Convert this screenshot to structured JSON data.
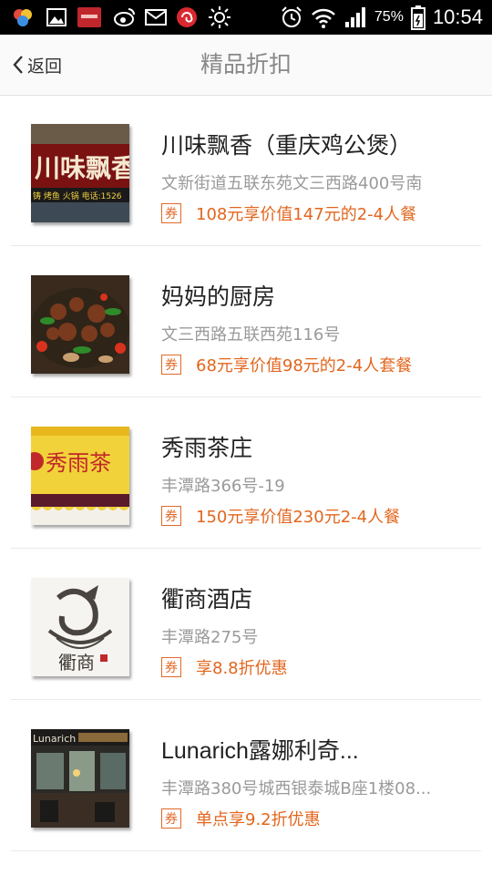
{
  "status_bar": {
    "battery": "75%",
    "time": "10:54",
    "icons": [
      "app-icon",
      "gallery-icon",
      "notification-icon",
      "weibo-icon",
      "mail-icon",
      "app-red-icon",
      "brightness-icon",
      "alarm-icon",
      "wifi-icon",
      "signal-icon",
      "battery-icon"
    ]
  },
  "header": {
    "back_label": "返回",
    "title": "精品折扣"
  },
  "items": [
    {
      "name": "川味飘香（重庆鸡公煲）",
      "address": "文新街道五联东苑文三西路400号南",
      "coupon": "券",
      "deal": "108元享价值147元的2-4人餐",
      "image_text": "川味飘香",
      "image_sub": "铸 烤鱼 火锅 电话:1526"
    },
    {
      "name": "妈妈的厨房",
      "address": "文三西路五联西苑116号",
      "coupon": "券",
      "deal": "68元享价值98元的2-4人套餐"
    },
    {
      "name": "秀雨茶庄",
      "address": "丰潭路366号-19",
      "coupon": "券",
      "deal": "150元享价值230元2-4人餐",
      "image_text": "秀雨茶"
    },
    {
      "name": "衢商酒店",
      "address": "丰潭路275号",
      "coupon": "券",
      "deal": "享8.8折优惠",
      "image_text": "衢商"
    },
    {
      "name": "Lunarich露娜利奇...",
      "address": "丰潭路380号城西银泰城B座1楼08...",
      "coupon": "券",
      "deal": "单点享9.2折优惠",
      "image_text": "Lunarich"
    }
  ],
  "colors": {
    "accent": "#e2661e",
    "title": "#888888",
    "address": "#9a9a9a"
  }
}
